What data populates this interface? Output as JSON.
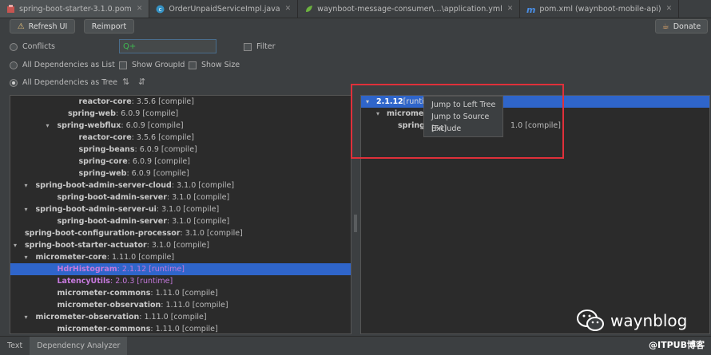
{
  "tabs": [
    {
      "label": "spring-boot-starter-3.1.0.pom",
      "icon": "maven-icon",
      "active": true
    },
    {
      "label": "OrderUnpaidServiceImpl.java",
      "icon": "java-class-icon",
      "active": false
    },
    {
      "label": "waynboot-message-consumer\\...\\application.yml",
      "icon": "spring-yml-icon",
      "active": false
    },
    {
      "label": "pom.xml (waynboot-mobile-api)",
      "icon": "maven-m-icon",
      "active": false
    }
  ],
  "toolbar": {
    "refresh_label": "Refresh UI",
    "reimport_label": "Reimport",
    "donate_label": "Donate"
  },
  "options": {
    "conflicts": "Conflicts",
    "filter": "Filter",
    "search_prefix": "Q+",
    "all_list": "All Dependencies as List",
    "show_groupid": "Show GroupId",
    "show_size": "Show Size",
    "all_tree": "All Dependencies as Tree"
  },
  "left_tree": [
    {
      "name": "reactor-core",
      "version": " : 3.5.6 [compile]",
      "indent": 5,
      "twisty": ""
    },
    {
      "name": "spring-web",
      "version": " : 6.0.9 [compile]",
      "indent": 4,
      "twisty": ""
    },
    {
      "name": "spring-webflux",
      "version": " : 6.0.9 [compile]",
      "indent": 3,
      "twisty": "▾"
    },
    {
      "name": "reactor-core",
      "version": " : 3.5.6 [compile]",
      "indent": 5,
      "twisty": ""
    },
    {
      "name": "spring-beans",
      "version": " : 6.0.9 [compile]",
      "indent": 5,
      "twisty": ""
    },
    {
      "name": "spring-core",
      "version": " : 6.0.9 [compile]",
      "indent": 5,
      "twisty": ""
    },
    {
      "name": "spring-web",
      "version": " : 6.0.9 [compile]",
      "indent": 5,
      "twisty": ""
    },
    {
      "name": "spring-boot-admin-server-cloud",
      "version": " : 3.1.0 [compile]",
      "indent": 1,
      "twisty": "▾"
    },
    {
      "name": "spring-boot-admin-server",
      "version": " : 3.1.0 [compile]",
      "indent": 3,
      "twisty": ""
    },
    {
      "name": "spring-boot-admin-server-ui",
      "version": " : 3.1.0 [compile]",
      "indent": 1,
      "twisty": "▾"
    },
    {
      "name": "spring-boot-admin-server",
      "version": " : 3.1.0 [compile]",
      "indent": 3,
      "twisty": ""
    },
    {
      "name": "spring-boot-configuration-processor",
      "version": " : 3.1.0 [compile]",
      "indent": 0,
      "twisty": ""
    },
    {
      "name": "spring-boot-starter-actuator",
      "version": " : 3.1.0 [compile]",
      "indent": 0,
      "twisty": "▾"
    },
    {
      "name": "micrometer-core",
      "version": " : 1.11.0 [compile]",
      "indent": 1,
      "twisty": "▾"
    },
    {
      "name": "HdrHistogram",
      "version": " : 2.1.12 [runtime]",
      "indent": 3,
      "twisty": "",
      "selected": true
    },
    {
      "name": "LatencyUtils",
      "version": " : 2.0.3 [runtime]",
      "indent": 3,
      "twisty": "",
      "highlight": true
    },
    {
      "name": "micrometer-commons",
      "version": " : 1.11.0 [compile]",
      "indent": 3,
      "twisty": ""
    },
    {
      "name": "micrometer-observation",
      "version": " : 1.11.0 [compile]",
      "indent": 3,
      "twisty": ""
    },
    {
      "name": "micrometer-observation",
      "version": " : 1.11.0 [compile]",
      "indent": 1,
      "twisty": "▾"
    },
    {
      "name": "micrometer-commons",
      "version": " : 1.11.0 [compile]",
      "indent": 3,
      "twisty": ""
    }
  ],
  "right_tree": {
    "root_name": "2.1.12",
    "root_version": " [runtim",
    "child_name": "micromet",
    "grandchild_name": "spring",
    "grandchild_version": "1.0 [compile]"
  },
  "context_menu": [
    "Jump to Left Tree",
    "Jump to Source [F4]",
    "Exclude"
  ],
  "bottom_tabs": [
    {
      "label": "Text",
      "active": false
    },
    {
      "label": "Dependency Analyzer",
      "active": true
    }
  ],
  "watermark": {
    "text": "waynblog",
    "credit": "@ITPUB博客"
  },
  "colors": {
    "accent_selection": "#2f65ca",
    "runtime_highlight": "#c679dd",
    "annotation_box": "#e0303a"
  }
}
